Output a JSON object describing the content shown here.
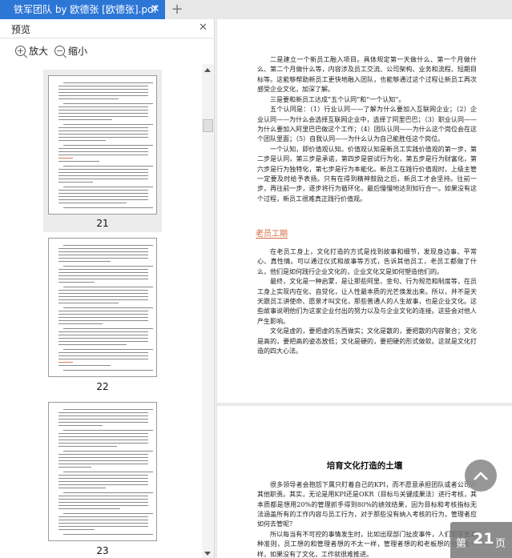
{
  "tab": {
    "title": "铁军团队 by 欧德张 [欧德张].pdf",
    "close": "✕",
    "new": "+"
  },
  "preview": {
    "title": "预览",
    "close": "✕",
    "zoom_in": "放大",
    "zoom_out": "缩小",
    "thumbnails": [
      {
        "page": "21",
        "selected": true
      },
      {
        "page": "22",
        "selected": false
      },
      {
        "page": "23",
        "selected": false
      }
    ]
  },
  "page1": {
    "paragraphs_top": [
      "二是建立一个新员工融入项目。具体规定第一天做什么、第一个月做什么、第二个月做什么等，内容涉及员工交流、公司架构、业务和流程、短期目标等。这能够帮助新员工更快地融入团队，也能够通过这个过程让新员工再次感受企业文化，加深了解。",
      "三是要和新员工达成“五个认同”和“一个认知”。",
      "五个认同是：（1）行业认同——了解为什么要加入互联网企业；（2）企业认同——为什么会选择互联网企业中，选择了阿里巴巴；（3）职业认同——为什么要加入阿里巴巴做这个工作；（4）团队认同——为什么这个岗位会在这个团队里面；（5）自我认同——为什么认为自己能胜任这个岗位。",
      "一个认知，即价值观认知。价值观认知是新员工实践价值观的第一步，第二步是认同，第三步是承诺，第四步是尝试行为化，第五步是行为财富化，第六步是行为独特化，第七步是行为本能化。新员工在践行价值观时，上级主管一定要及时给予表扬。只有在得到精神鼓励之后，新员工才会坚持。往前一步，再往前一步，逐步将行为循环化，最后慢慢地达到知行合一。如果没有这个过程，新员工很难真正践行价值观。"
    ],
    "section_heading": "老员工期",
    "paragraphs_bottom": [
      "在老员工身上，文化打造的方式是找到故事和细节，发现身边事、平常心、真性情。可以通过仪式和故事等方式，告诉其他员工，老员工都做了什么，他们是如何践行企业文化的，企业文化又是如何塑造他们的。",
      "最终，文化是一种启蒙，是让那些阿里、金句、行为规范和制度等，在员工身上实现内在化、自觉化，让人性最本质的光芒焕发出来。所以，并不是天天跟员工讲使命、愿景才叫文化，那些普通人的人生故事，也是企业文化。这些故事说明他们为这家企业付出的努力以及与企业文化的连接。这些会对他人产生影响。",
      "文化是虚的，要把虚的东西做实；文化是散的，要把散的内容聚合；文化是高的，要把高的姿态放低；文化是硬的，要把硬的形式做软。这就是文化打造的四大心法。"
    ]
  },
  "page2": {
    "title": "培育文化打造的土壤",
    "paragraphs": [
      "很多领导者会抱怨下属只盯着自己的KPI，而不愿意承担团队或者公司的其他职责。其实，无论是用KPI还是OKR（目标与关键成果法）进行考核，其本质都是想用20%的管理抓手得到80%的绩效结果，因为目标和考核指标无法涵盖所有的工作内容与员工行为，对于那些没有纳入考核的行为，管理者应如何去管呢？",
      "所以每当有不可控的事情发生时，比如出现部门扯皮事件，人们都需要某种准则，员工想的和管理者想的不太一样，管理者想的和老板想的也不太一样，如果没有了文化，工作就很难推进。"
    ]
  },
  "page_indicator": {
    "prefix": "第",
    "current": "21",
    "suffix": "页"
  },
  "colors": {
    "tab_active": "#2c76d6",
    "section_heading": "#d66a3e"
  }
}
